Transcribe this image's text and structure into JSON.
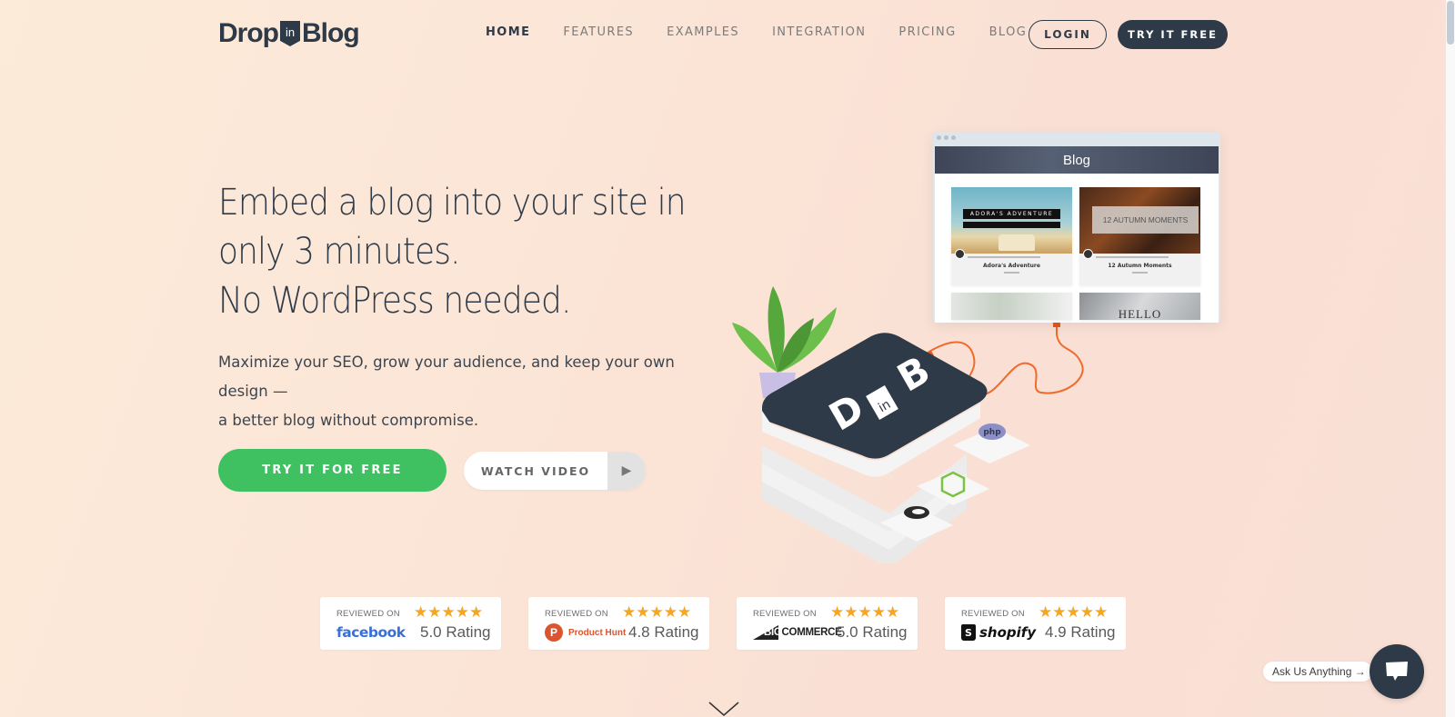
{
  "header": {
    "logo": {
      "left": "Drop",
      "badge": "in",
      "right": "Blog"
    },
    "nav": [
      {
        "label": "HOME",
        "active": true
      },
      {
        "label": "FEATURES",
        "active": false
      },
      {
        "label": "EXAMPLES",
        "active": false
      },
      {
        "label": "INTEGRATION",
        "active": false
      },
      {
        "label": "PRICING",
        "active": false
      },
      {
        "label": "BLOG",
        "active": false
      }
    ],
    "login_label": "LOGIN",
    "try_label": "TRY IT FREE"
  },
  "hero": {
    "title_lines": [
      "Embed a blog into your site in",
      "only 3 minutes.",
      "No WordPress needed."
    ],
    "subtitle_lines": [
      "Maximize your SEO, grow your audience, and keep your own design —",
      "a better blog without compromise."
    ],
    "cta_label": "TRY IT FOR FREE",
    "video_label": "WATCH VIDEO",
    "play_icon": "▶"
  },
  "illustration": {
    "browser_title": "Blog",
    "cards": [
      {
        "image_text": "ADORA'S ADVENTURE",
        "title": "Adora's Adventure"
      },
      {
        "image_text": "12 AUTUMN MOMENTS",
        "title": "12 Autumn Moments"
      },
      {
        "image_text": "",
        "title": ""
      },
      {
        "image_text": "HELLO",
        "title": ""
      }
    ],
    "cube_letters": {
      "left": "D",
      "badge": "in",
      "right": "B"
    },
    "ports": [
      "php",
      "node-js",
      "other"
    ]
  },
  "reviews": [
    {
      "label": "REVIEWED ON",
      "platform": "facebook",
      "rating": "5.0 Rating",
      "stars": 5
    },
    {
      "label": "REVIEWED ON",
      "platform": "Product Hunt",
      "rating": "4.8 Rating",
      "stars": 5
    },
    {
      "label": "REVIEWED ON",
      "platform": "BIGCOMMERCE",
      "platform_big": "BIG",
      "platform_rest": "COMMERCE",
      "rating": "5.0 Rating",
      "stars": 5
    },
    {
      "label": "REVIEWED ON",
      "platform": "shopify",
      "rating": "4.9 Rating",
      "stars": 5
    }
  ],
  "chat": {
    "prompt": "Ask Us Anything →"
  },
  "colors": {
    "brand_dark": "#2e3a47",
    "cta_green": "#3fc061",
    "star": "#f5a623",
    "cable": "#f06a2c"
  }
}
